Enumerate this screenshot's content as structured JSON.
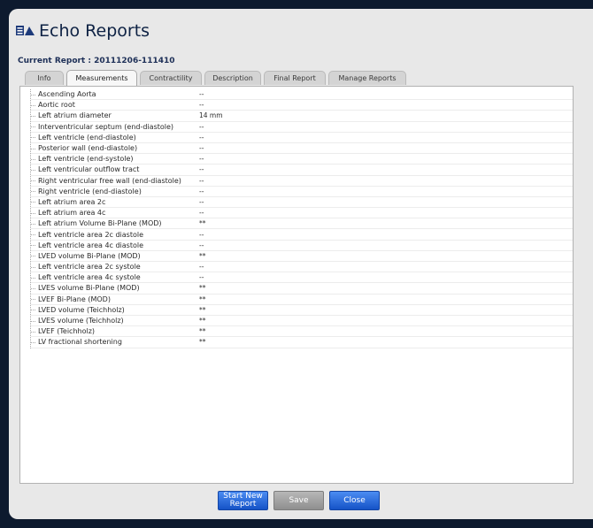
{
  "app": {
    "title": "Echo Reports"
  },
  "current_report": {
    "label": "Current Report : 20111206-111410"
  },
  "tabs": [
    {
      "label": "Info",
      "active": false
    },
    {
      "label": "Measurements",
      "active": true
    },
    {
      "label": "Contractility",
      "active": false
    },
    {
      "label": "Description",
      "active": false
    },
    {
      "label": "Final Report",
      "active": false
    },
    {
      "label": "Manage Reports",
      "active": false
    }
  ],
  "measurements": [
    {
      "label": "Ascending Aorta",
      "value": "--"
    },
    {
      "label": "Aortic root",
      "value": "--"
    },
    {
      "label": "Left atrium diameter",
      "value": "14 mm"
    },
    {
      "label": "Interventricular septum (end-diastole)",
      "value": "--"
    },
    {
      "label": "Left ventricle (end-diastole)",
      "value": "--"
    },
    {
      "label": "Posterior wall (end-diastole)",
      "value": "--"
    },
    {
      "label": "Left ventricle (end-systole)",
      "value": "--"
    },
    {
      "label": "Left ventricular outflow tract",
      "value": "--"
    },
    {
      "label": "Right ventricular free wall (end-diastole)",
      "value": "--"
    },
    {
      "label": "Right ventricle (end-diastole)",
      "value": "--"
    },
    {
      "label": "Left atrium area 2c",
      "value": "--"
    },
    {
      "label": "Left atrium area 4c",
      "value": "--"
    },
    {
      "label": "Left atrium Volume Bi-Plane (MOD)",
      "value": "**"
    },
    {
      "label": "Left ventricle area 2c diastole",
      "value": "--"
    },
    {
      "label": "Left ventricle area 4c diastole",
      "value": "--"
    },
    {
      "label": "LVED volume Bi-Plane (MOD)",
      "value": "**"
    },
    {
      "label": "Left ventricle area 2c systole",
      "value": "--"
    },
    {
      "label": "Left ventricle area 4c systole",
      "value": "--"
    },
    {
      "label": "LVES volume Bi-Plane (MOD)",
      "value": "**"
    },
    {
      "label": "LVEF Bi-Plane (MOD)",
      "value": "**"
    },
    {
      "label": "LVED volume (Teichholz)",
      "value": "**"
    },
    {
      "label": "LVES volume (Teichholz)",
      "value": "**"
    },
    {
      "label": "LVEF (Teichholz)",
      "value": "**"
    },
    {
      "label": "LV fractional shortening",
      "value": "**"
    }
  ],
  "buttons": {
    "start_new_line1": "Start New",
    "start_new_line2": "Report",
    "save": "Save",
    "close": "Close"
  },
  "icons": {
    "app": "echo-chart-icon"
  },
  "colors": {
    "accent": "#1e5fd6",
    "title": "#0e2244"
  }
}
